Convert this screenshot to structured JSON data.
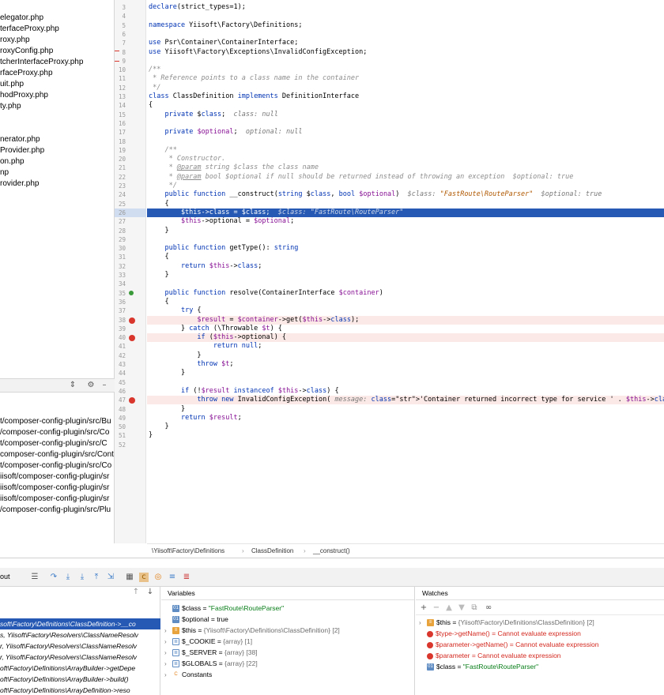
{
  "project_files": [
    "elegator.php",
    "terfaceProxy.php",
    "roxy.php",
    "roxyConfig.php",
    "tcherInterfaceProxy.php",
    "rfaceProxy.php",
    "uit.php",
    "hodProxy.php",
    "ty.php",
    "nerator.php",
    "Provider.php",
    "on.php",
    "np",
    "rovider.php"
  ],
  "find_results": [
    "t/composer-config-plugin/src/Bu",
    "/composer-config-plugin/src/Co",
    "t/composer-config-plugin/src/C",
    "composer-config-plugin/src/Cont",
    "t/composer-config-plugin/src/Co",
    "iisoft/composer-config-plugin/sr",
    "iisoft/composer-config-plugin/sr",
    "iisoft/composer-config-plugin/sr",
    "/composer-config-plugin/src/Plu"
  ],
  "code_lines": [
    {
      "n": "3",
      "c": "declare(strict_types=1);"
    },
    {
      "n": "4",
      "c": ""
    },
    {
      "n": "5",
      "c": "namespace Yiisoft\\Factory\\Definitions;"
    },
    {
      "n": "6",
      "c": ""
    },
    {
      "n": "7",
      "c": "use Psr\\Container\\ContainerInterface;"
    },
    {
      "n": "8",
      "c": "use Yiisoft\\Factory\\Exceptions\\InvalidConfigException;"
    },
    {
      "n": "9",
      "c": ""
    },
    {
      "n": "10",
      "c": "/**"
    },
    {
      "n": "11",
      "c": " * Reference points to a class name in the container"
    },
    {
      "n": "12",
      "c": " */"
    },
    {
      "n": "13",
      "c": "class ClassDefinition implements DefinitionInterface"
    },
    {
      "n": "14",
      "c": "{"
    },
    {
      "n": "15",
      "c": "    private $class;  class: null"
    },
    {
      "n": "16",
      "c": ""
    },
    {
      "n": "17",
      "c": "    private $optional;  optional: null"
    },
    {
      "n": "18",
      "c": ""
    },
    {
      "n": "19",
      "c": "    /**"
    },
    {
      "n": "20",
      "c": "     * Constructor."
    },
    {
      "n": "21",
      "c": "     * @param string $class the class name"
    },
    {
      "n": "22",
      "c": "     * @param bool $optional if null should be returned instead of throwing an exception  $optional: true"
    },
    {
      "n": "23",
      "c": "     */"
    },
    {
      "n": "24",
      "c": "    public function __construct(string $class, bool $optional)  $class: \"FastRoute\\RouteParser\"  $optional: true"
    },
    {
      "n": "25",
      "c": "    {"
    },
    {
      "n": "26",
      "c": "        $this->class = $class;  $class: \"FastRoute\\RouteParser\""
    },
    {
      "n": "27",
      "c": "        $this->optional = $optional;"
    },
    {
      "n": "28",
      "c": "    }"
    },
    {
      "n": "29",
      "c": ""
    },
    {
      "n": "30",
      "c": "    public function getType(): string"
    },
    {
      "n": "31",
      "c": "    {"
    },
    {
      "n": "32",
      "c": "        return $this->class;"
    },
    {
      "n": "33",
      "c": "    }"
    },
    {
      "n": "34",
      "c": ""
    },
    {
      "n": "35",
      "c": "    public function resolve(ContainerInterface $container)"
    },
    {
      "n": "36",
      "c": "    {"
    },
    {
      "n": "37",
      "c": "        try {"
    },
    {
      "n": "38",
      "c": "            $result = $container->get($this->class);"
    },
    {
      "n": "39",
      "c": "        } catch (\\Throwable $t) {"
    },
    {
      "n": "40",
      "c": "            if ($this->optional) {"
    },
    {
      "n": "41",
      "c": "                return null;"
    },
    {
      "n": "42",
      "c": "            }"
    },
    {
      "n": "43",
      "c": "            throw $t;"
    },
    {
      "n": "44",
      "c": "        }"
    },
    {
      "n": "45",
      "c": ""
    },
    {
      "n": "46",
      "c": "        if (!$result instanceof $this->class) {"
    },
    {
      "n": "47",
      "c": "            throw new InvalidConfigException( message: 'Container returned incorrect type for service ' . $this->class);"
    },
    {
      "n": "48",
      "c": "        }"
    },
    {
      "n": "49",
      "c": "        return $result;"
    },
    {
      "n": "50",
      "c": "    }"
    },
    {
      "n": "51",
      "c": "}"
    },
    {
      "n": "52",
      "c": ""
    }
  ],
  "breadcrumb": [
    "\\Yiisoft\\Factory\\Definitions",
    "ClassDefinition",
    "__construct()"
  ],
  "debug_toolbar": {
    "left_label": "out"
  },
  "frames": [
    "soft\\Factory\\Definitions\\ClassDefinition->__co",
    "s, Yiisoft\\Factory\\Resolvers\\ClassNameResolv",
    "r, Yiisoft\\Factory\\Resolvers\\ClassNameResolv",
    "r, Yiisoft\\Factory\\Resolvers\\ClassNameResolv",
    "oft\\Factory\\Definitions\\ArrayBuilder->getDepe",
    "oft\\Factory\\Definitions\\ArrayBuilder->build()",
    "oft\\Factory\\Definitions\\ArrayDefinition->reso"
  ],
  "variables_title": "Variables",
  "variables": [
    {
      "badge": "01",
      "name": "$class",
      "eq": " = ",
      "val": "\"FastRoute\\RouteParser\"",
      "kind": "str"
    },
    {
      "badge": "01",
      "name": "$optional",
      "eq": " = ",
      "val": "true",
      "kind": "plain"
    },
    {
      "badge": "obj",
      "name": "$this",
      "eq": " = ",
      "val": "{Yiisoft\\Factory\\Definitions\\ClassDefinition} [2]",
      "kind": "obj",
      "expand": true
    },
    {
      "badge": "arr",
      "name": "$_COOKIE",
      "eq": " = ",
      "val": "{array} [1]",
      "kind": "obj",
      "expand": true
    },
    {
      "badge": "arr",
      "name": "$_SERVER",
      "eq": " = ",
      "val": "{array} [38]",
      "kind": "obj",
      "expand": true
    },
    {
      "badge": "arr",
      "name": "$GLOBALS",
      "eq": " = ",
      "val": "{array} [22]",
      "kind": "obj",
      "expand": true
    },
    {
      "badge": "const",
      "name": "Constants",
      "eq": "",
      "val": "",
      "kind": "plain",
      "expand": true
    }
  ],
  "watches_title": "Watches",
  "watches": [
    {
      "icon": "obj",
      "name": "$this",
      "eq": " = ",
      "val": "{Yiisoft\\Factory\\Definitions\\ClassDefinition} [2]",
      "kind": "obj",
      "expand": true
    },
    {
      "icon": "err",
      "name": "$type->getName()",
      "eq": " = ",
      "val": "Cannot evaluate expression",
      "kind": "err"
    },
    {
      "icon": "err",
      "name": "$parameter->getName()",
      "eq": " = ",
      "val": "Cannot evaluate expression",
      "kind": "err"
    },
    {
      "icon": "err",
      "name": "$parameter",
      "eq": " = ",
      "val": "Cannot evaluate expression",
      "kind": "err"
    },
    {
      "icon": "01",
      "name": "$class",
      "eq": " = ",
      "val": "\"FastRoute\\RouteParser\"",
      "kind": "str"
    }
  ],
  "colors": {
    "selection": "#2559b3",
    "breakpoint_line": "#fae9e6",
    "keyword": "#0033b3",
    "string": "#067d17",
    "error": "#d3281f"
  }
}
